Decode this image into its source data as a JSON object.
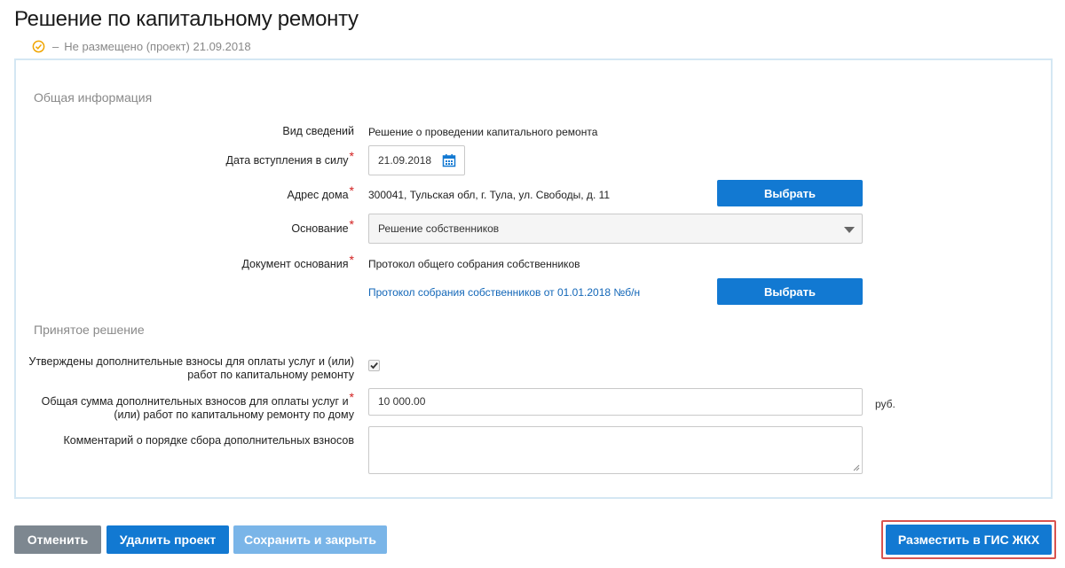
{
  "page": {
    "title": "Решение по капитальному ремонту",
    "status_dash": "–",
    "status_text": "Не размещено (проект) 21.09.2018"
  },
  "sections": {
    "general": "Общая информация",
    "decision": "Принятое решение"
  },
  "fields": {
    "info_type": {
      "label": "Вид сведений",
      "value": "Решение о проведении капитального ремонта"
    },
    "effective_date": {
      "label": "Дата вступления в силу",
      "value": "21.09.2018"
    },
    "address": {
      "label": "Адрес дома",
      "value": "300041, Тульская обл, г. Тула, ул. Свободы, д. 11",
      "button": "Выбрать"
    },
    "basis": {
      "label": "Основание",
      "value": "Решение собственников"
    },
    "basis_doc": {
      "label": "Документ основания",
      "value": "Протокол общего собрания собственников",
      "link": "Протокол собрания собственников от 01.01.2018 №б/н",
      "button": "Выбрать"
    },
    "extra_fees_approved": {
      "label_line1": "Утверждены дополнительные взносы для оплаты услуг и (или)",
      "label_line2": "работ по капитальному ремонту",
      "checked": true
    },
    "extra_fees_total": {
      "label_line1": "Общая сумма дополнительных взносов для оплаты услуг и",
      "label_line2": "(или) работ по капитальному ремонту по дому",
      "value": "10 000.00",
      "unit": "руб."
    },
    "comment": {
      "label": "Комментарий о порядке сбора дополнительных взносов",
      "value": ""
    }
  },
  "required_mark": "*",
  "footer": {
    "cancel": "Отменить",
    "delete": "Удалить проект",
    "save_close": "Сохранить и закрыть",
    "publish": "Разместить в ГИС ЖКХ"
  },
  "colors": {
    "primary": "#1279d2",
    "disabled": "#7ab5e8",
    "secondary": "#7d8790",
    "required": "#d21f1f",
    "highlight": "#d9534f",
    "status_icon": "#f0a500"
  }
}
